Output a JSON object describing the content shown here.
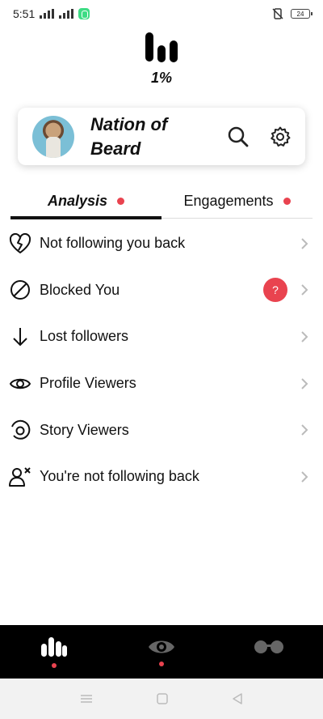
{
  "status_bar": {
    "time": "5:51",
    "battery": "24"
  },
  "header": {
    "percentage": "1%"
  },
  "profile": {
    "name": "Nation of Beard"
  },
  "tabs": [
    {
      "label": "Analysis",
      "active": true,
      "has_dot": true
    },
    {
      "label": "Engagements",
      "active": false,
      "has_dot": true
    }
  ],
  "menu": [
    {
      "label": "Not following you back",
      "icon": "broken-heart-icon"
    },
    {
      "label": "Blocked You",
      "icon": "blocked-icon",
      "badge": "?"
    },
    {
      "label": "Lost followers",
      "icon": "arrow-down-icon"
    },
    {
      "label": "Profile Viewers",
      "icon": "eye-icon"
    },
    {
      "label": "Story Viewers",
      "icon": "story-icon"
    },
    {
      "label": "You're not following back",
      "icon": "user-remove-icon"
    }
  ],
  "bottom_nav": [
    {
      "icon": "analytics-icon",
      "active": true
    },
    {
      "icon": "eye-nav-icon",
      "active": false
    },
    {
      "icon": "glasses-icon",
      "active": false
    }
  ],
  "colors": {
    "accent": "#e9434f",
    "dark": "#000000"
  }
}
